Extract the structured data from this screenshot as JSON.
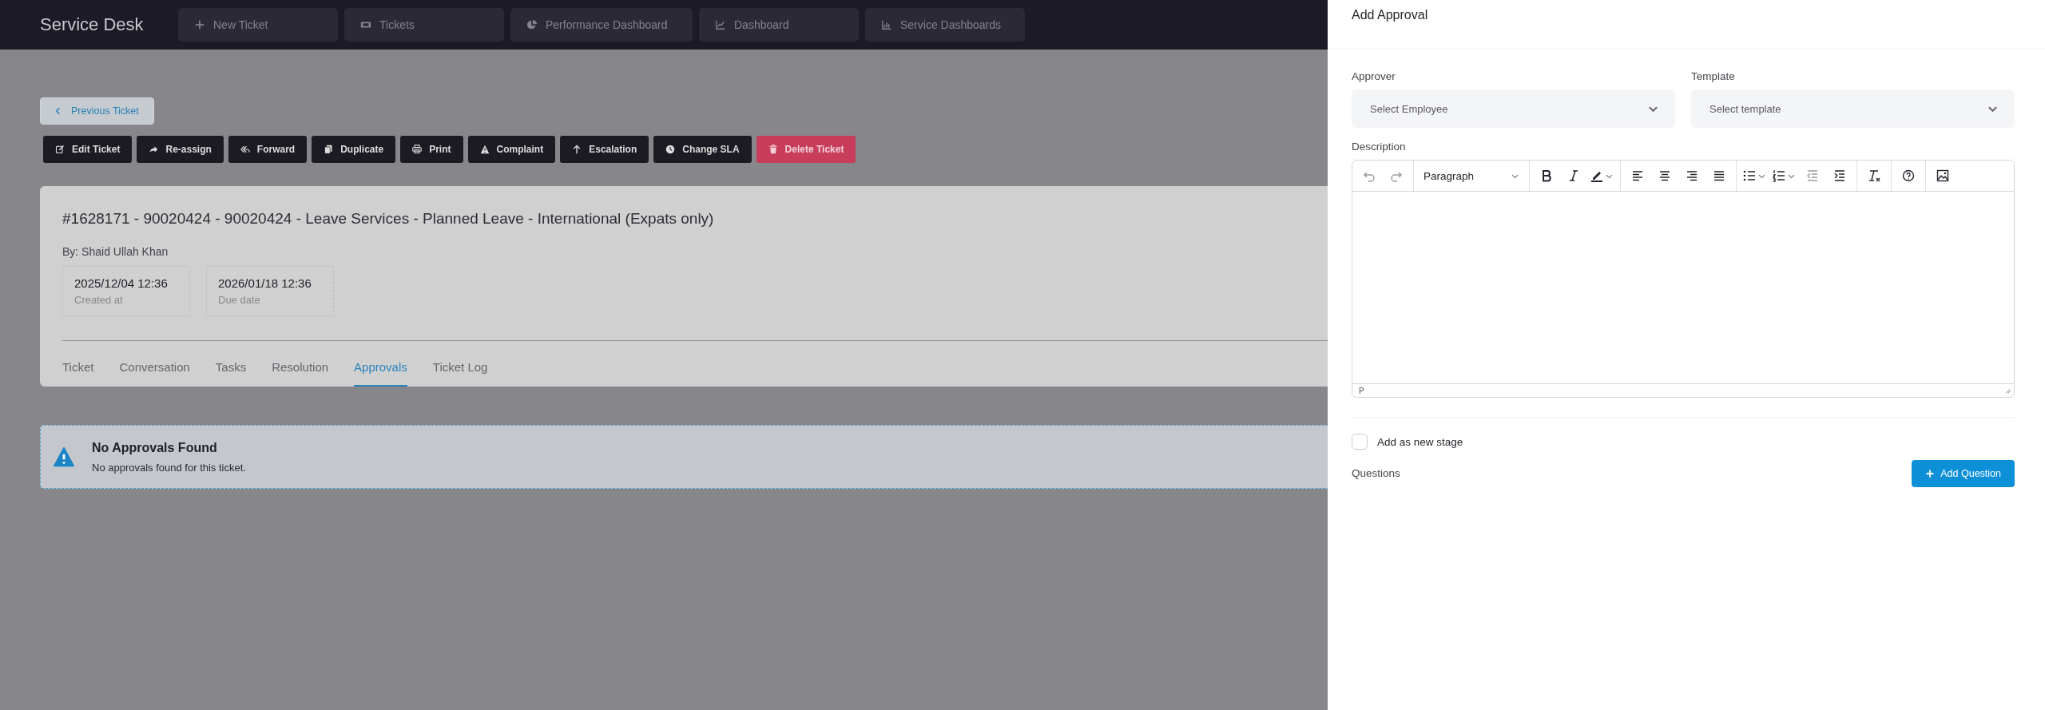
{
  "nav": {
    "brand": "Service Desk",
    "items": [
      {
        "label": "New Ticket",
        "kind": "plus"
      },
      {
        "label": "Tickets",
        "kind": "ticket"
      },
      {
        "label": "Performance Dashboard",
        "kind": "pie"
      },
      {
        "label": "Dashboard",
        "kind": "line"
      },
      {
        "label": "Service Dashboards",
        "kind": "bars"
      }
    ]
  },
  "previous_button": "Previous Ticket",
  "actions": [
    {
      "label": "Edit Ticket",
      "kind": "edit",
      "danger": false
    },
    {
      "label": "Re-assign",
      "kind": "share",
      "danger": false
    },
    {
      "label": "Forward",
      "kind": "replyall",
      "danger": false
    },
    {
      "label": "Duplicate",
      "kind": "copy",
      "danger": false
    },
    {
      "label": "Print",
      "kind": "print",
      "danger": false
    },
    {
      "label": "Complaint",
      "kind": "warning",
      "danger": false
    },
    {
      "label": "Escalation",
      "kind": "up",
      "danger": false
    },
    {
      "label": "Change SLA",
      "kind": "clock",
      "danger": false
    },
    {
      "label": "Delete Ticket",
      "kind": "trash",
      "danger": true
    }
  ],
  "ticket": {
    "title": "#1628171 - 90020424 - 90020424 - Leave Services - Planned Leave - International (Expats only)",
    "author": "By: Shaid Ullah Khan",
    "dates": [
      {
        "value": "2025/12/04 12:36",
        "label": "Created at"
      },
      {
        "value": "2026/01/18 12:36",
        "label": "Due date"
      }
    ],
    "tabs": [
      {
        "label": "Ticket",
        "selected": false
      },
      {
        "label": "Conversation",
        "selected": false
      },
      {
        "label": "Tasks",
        "selected": false
      },
      {
        "label": "Resolution",
        "selected": false
      },
      {
        "label": "Approvals",
        "selected": true
      },
      {
        "label": "Ticket Log",
        "selected": false
      }
    ]
  },
  "alert": {
    "title": "No Approvals Found",
    "message": "No approvals found for this ticket."
  },
  "panel": {
    "title": "Add Approval",
    "approver": {
      "label": "Approver",
      "placeholder": "Select Employee"
    },
    "template": {
      "label": "Template",
      "placeholder": "Select template"
    },
    "description": {
      "label": "Description",
      "block_format": "Paragraph",
      "status": "P"
    },
    "new_stage": {
      "label": "Add as new stage",
      "checked": false
    },
    "questions_label": "Questions",
    "add_question_button": "Add Question"
  }
}
